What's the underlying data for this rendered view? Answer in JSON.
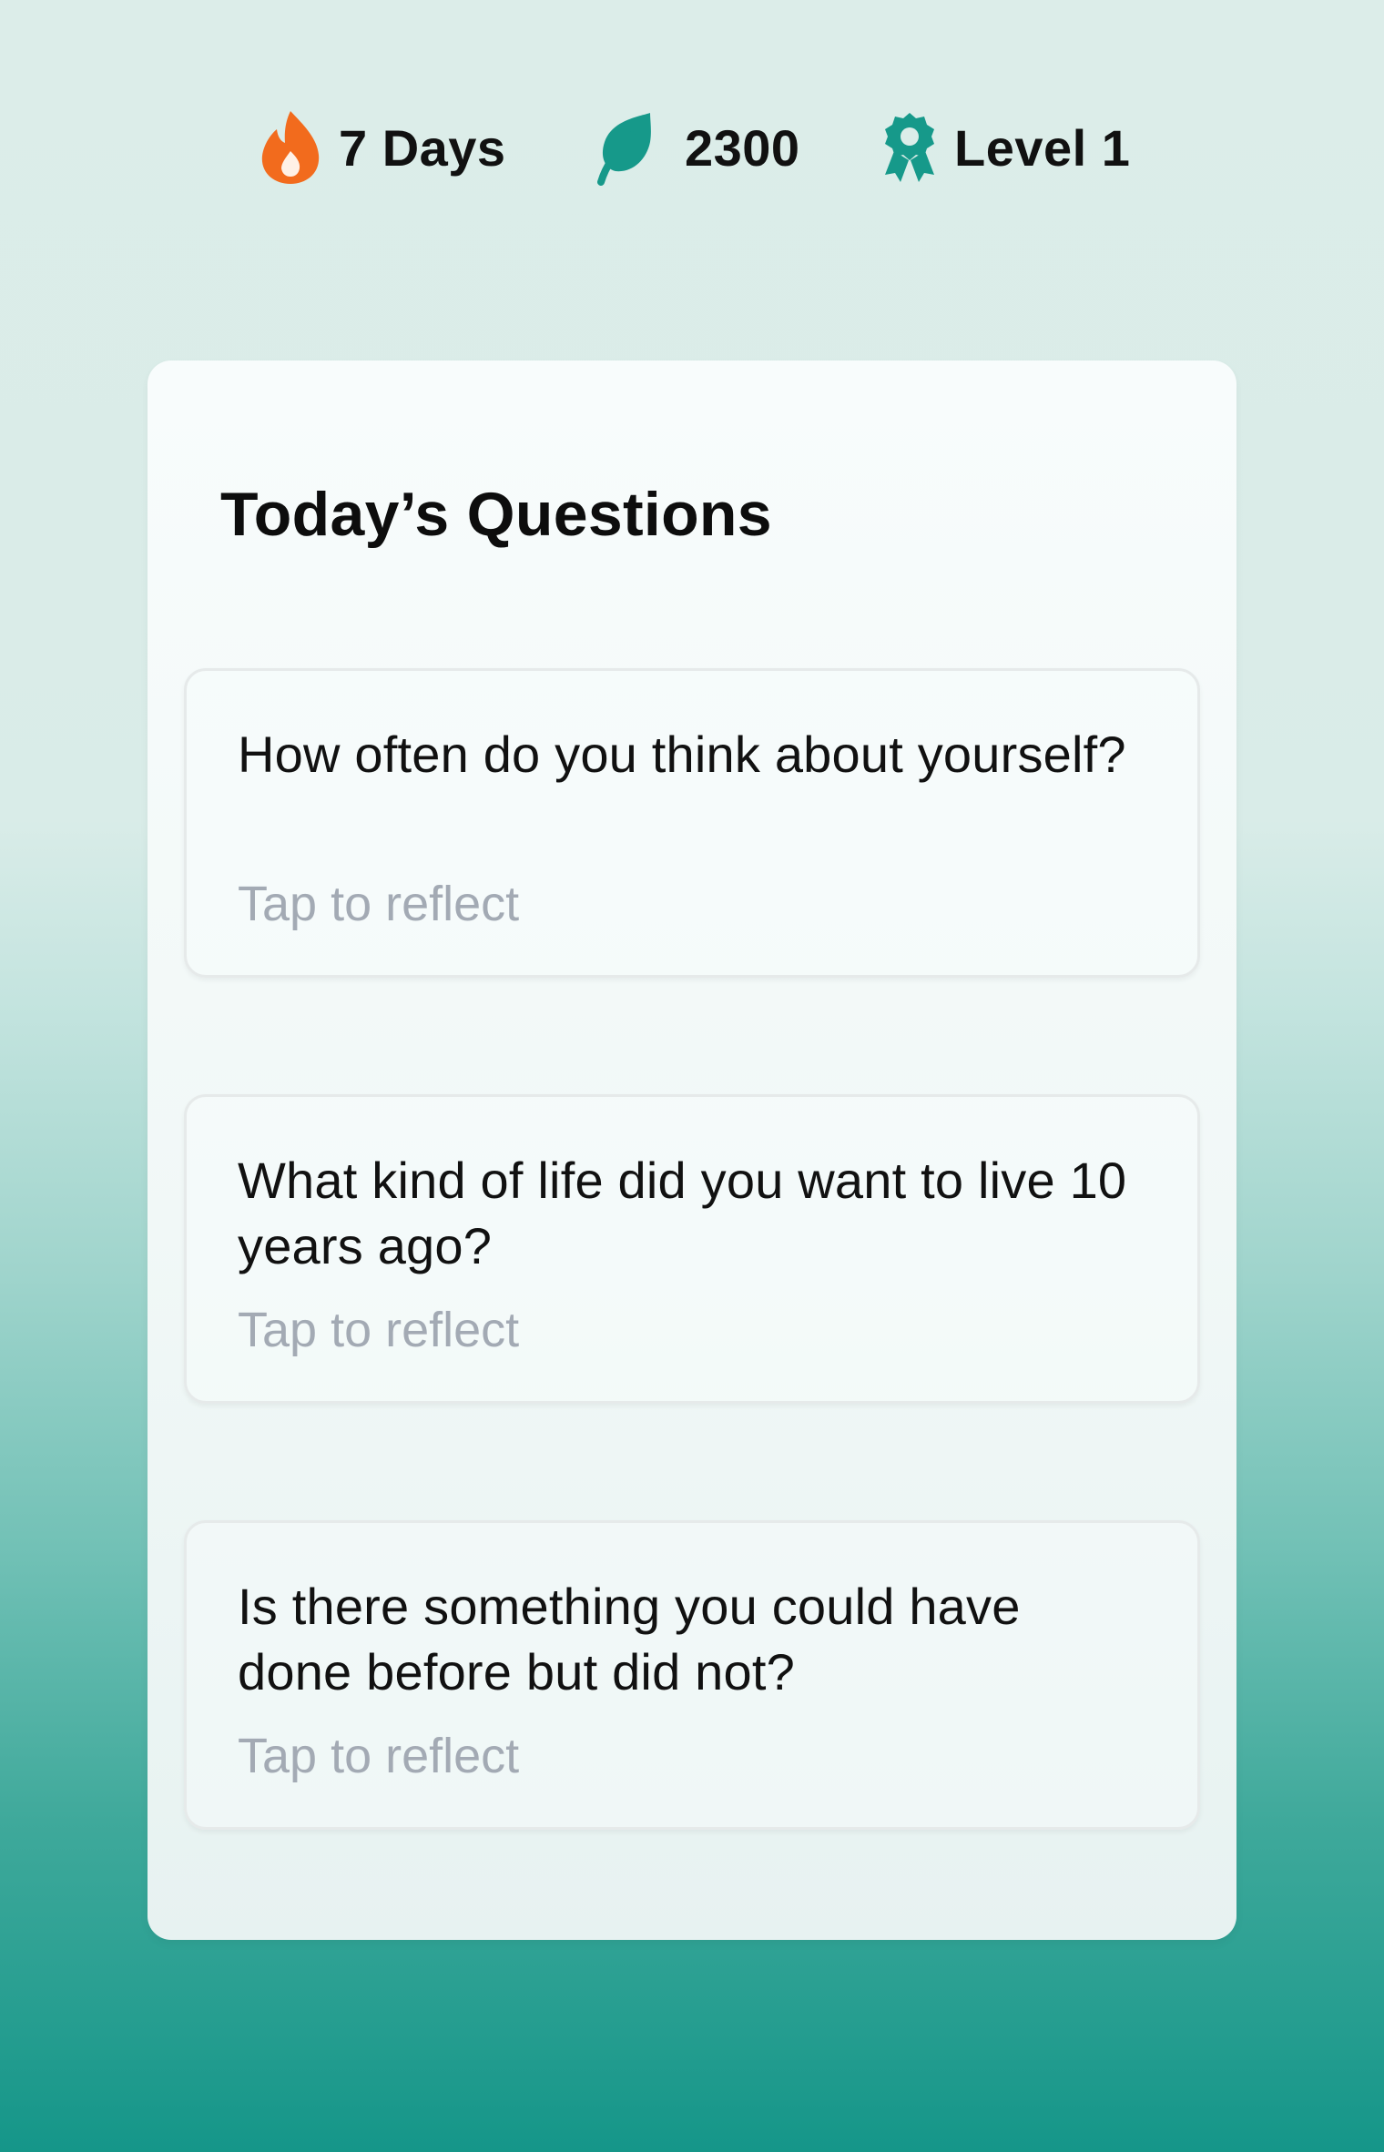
{
  "stats": {
    "streak": {
      "label": "7 Days",
      "icon": "flame-icon",
      "color": "#f26b1d"
    },
    "points": {
      "label": "2300",
      "icon": "leaf-icon",
      "color": "#16998a"
    },
    "level": {
      "label": "Level 1",
      "icon": "award-badge-icon",
      "color": "#16998a"
    }
  },
  "card": {
    "title": "Today’s Questions",
    "questions": [
      {
        "text": "How often do you think about yourself?",
        "hint": "Tap to reflect"
      },
      {
        "text": "What kind of life did you want to live 10 years ago?",
        "hint": "Tap to reflect"
      },
      {
        "text": "Is there something you could have done before but did not?",
        "hint": "Tap to reflect"
      }
    ]
  }
}
